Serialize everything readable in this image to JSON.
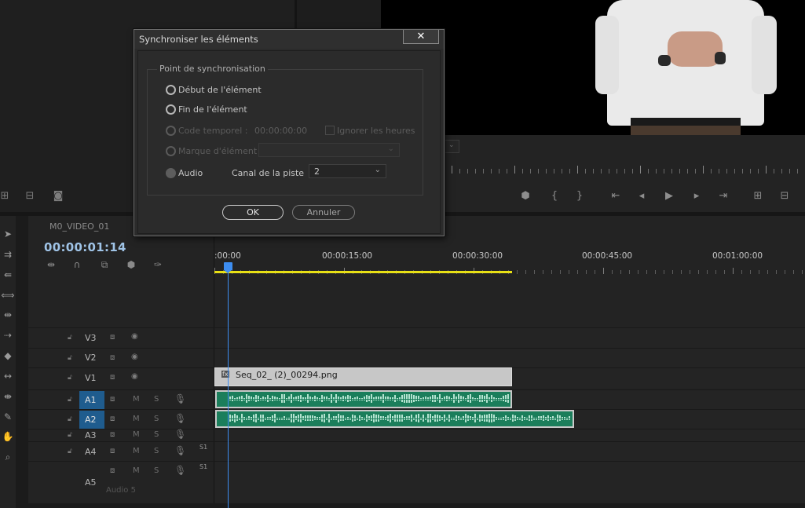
{
  "dialog": {
    "title": "Synchroniser les éléments",
    "close_glyph": "✕",
    "group_label": "Point de synchronisation",
    "options": {
      "start": "Début de l'élément",
      "end": "Fin de l'élément",
      "timecode": "Code temporel :",
      "marker": "Marque d'élément",
      "audio": "Audio"
    },
    "timecode_value": "00:00:00:00",
    "ignore_hours": "Ignorer les heures",
    "channel_label": "Canal de la piste",
    "channel_value": "2",
    "selected_option": "audio",
    "ok": "OK",
    "cancel": "Annuler"
  },
  "timeline": {
    "sequence_name": "M0_VIDEO_01",
    "timecode": "00:00:01:14",
    "ruler_labels": [
      ":00:00",
      "00:00:15:00",
      "00:00:30:00",
      "00:00:45:00",
      "00:01:00:00"
    ],
    "tracks": {
      "v3": "V3",
      "v2": "V2",
      "v1": "V1",
      "a1": "A1",
      "a2": "A2",
      "a3": "A3",
      "a4": "A4",
      "a5": "A5"
    },
    "a5_sub": "Audio 5",
    "mute_letter": "M",
    "solo_letter": "S",
    "channel_badge": "S1",
    "video_clip": "Seq_02_ (2)_00294.png",
    "clip_fx_badge": "fx"
  },
  "colors": {
    "accent_blue": "#3d8df0",
    "track_target": "#1f5c8e",
    "audio_clip": "#1b7e5b",
    "work_area": "#e8e015",
    "timecode": "#9fc3e6"
  }
}
